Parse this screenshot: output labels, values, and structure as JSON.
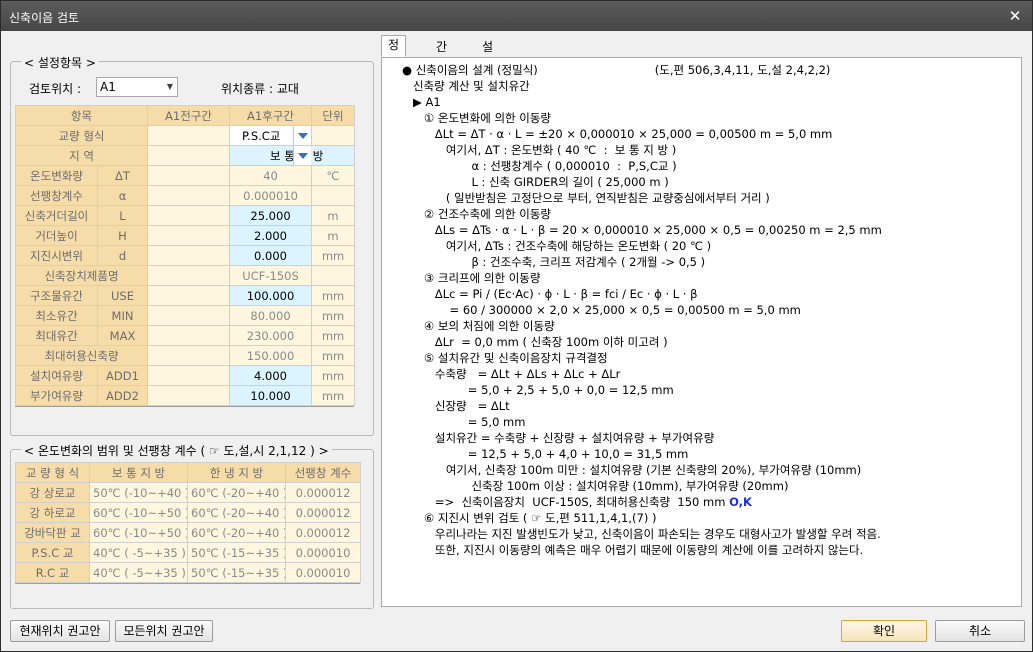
{
  "window": {
    "title": "신축이음 검토",
    "close": "✕"
  },
  "settings": {
    "group_title": "< 설정항목 >",
    "location_label": "검토위치 :",
    "location_value": "A1",
    "type_label": "위치종류 : 교대",
    "headers": [
      "항목",
      "A1전구간",
      "A1후구간",
      "단위"
    ],
    "rows": [
      {
        "label": "교량  형식",
        "front": "",
        "back": "P.S.C교",
        "unit": "",
        "kind": "select"
      },
      {
        "label": "지      역",
        "front": "",
        "back": "",
        "unit": "",
        "kind": "region",
        "value": "보 통 지 방"
      },
      {
        "label": "온도변화량",
        "symbol": "ΔT",
        "front": "",
        "back": "40",
        "unit": "℃"
      },
      {
        "label": "선팽창계수",
        "symbol": "α",
        "front": "",
        "back": "0.000010",
        "unit": ""
      },
      {
        "label": "신축거더길이",
        "symbol": "L",
        "front": "",
        "back": "25.000",
        "unit": "m",
        "edit": true
      },
      {
        "label": "거더높이",
        "symbol": "H",
        "front": "",
        "back": "2.000",
        "unit": "m",
        "edit": true
      },
      {
        "label": "지진시변위",
        "symbol": "d",
        "front": "",
        "back": "0.000",
        "unit": "mm",
        "edit": true
      },
      {
        "label": "신축장치제품명",
        "front": "",
        "back": "UCF-150S",
        "unit": "",
        "wide": true
      },
      {
        "label": "구조물유간",
        "symbol": "USE",
        "front": "",
        "back": "100.000",
        "unit": "mm",
        "edit": true
      },
      {
        "label": "최소유간",
        "symbol": "MIN",
        "front": "",
        "back": "80.000",
        "unit": "mm"
      },
      {
        "label": "최대유간",
        "symbol": "MAX",
        "front": "",
        "back": "230.000",
        "unit": "mm"
      },
      {
        "label": "최대허용신축량",
        "front": "",
        "back": "150.000",
        "unit": "mm",
        "wide": true
      },
      {
        "label": "설치여유량",
        "symbol": "ADD1",
        "front": "",
        "back": "4.000",
        "unit": "mm",
        "edit": true
      },
      {
        "label": "부가여유량",
        "symbol": "ADD2",
        "front": "",
        "back": "10.000",
        "unit": "mm",
        "edit": true
      }
    ]
  },
  "temp_range": {
    "group_title": "< 온도변화의 범위 및 선팽창 계수 ( ☞ 도,설,시 2,1,12 ) >",
    "headers": [
      "교 량 형 식",
      "보 통 지 방",
      "한 냉 지 방",
      "선팽창 계수"
    ],
    "rows": [
      [
        "강 상로교",
        "50℃ (-10~+40 )",
        "60℃ (-20~+40 )",
        "0.000012"
      ],
      [
        "강 하로교",
        "60℃ (-10~+50 )",
        "60℃ (-20~+40 )",
        "0.000012"
      ],
      [
        "강바닥판 교",
        "60℃ (-10~+50 )",
        "60℃ (-20~+40 )",
        "0.000012"
      ],
      [
        "P.S.C 교",
        "40℃ ( -5~+35 )",
        "50℃ (-15~+35 )",
        "0.000010"
      ],
      [
        "R.C 교",
        "40℃ ( -5~+35 )",
        "50℃ (-15~+35 )",
        "0.000010"
      ]
    ]
  },
  "tabs": [
    "정밀식",
    "간편식",
    "설계점검"
  ],
  "report": {
    "lines": [
      "● 신축이음의 설계 (정밀식)                                (도,편 506,3,4,11, 도,설 2,4,2,2)",
      "   신축량 계산 및 설치유간",
      "   ▶ A1",
      "      ① 온도변화에 의한 이동량",
      "         ΔLt = ΔT · α · L = ±20 × 0,000010 × 25,000 = 0,00500 m = 5,0 mm",
      "            여기서, ΔT : 온도변화 ( 40 ℃  :  보 통 지 방 )",
      "                   α : 선팽창계수 ( 0,000010  :  P,S,C교 )",
      "                   L : 신축 GIRDER의 길이 ( 25,000 m )",
      "            ( 일반받침은 고정단으로 부터, 연직받침은 교량중심에서부터 거리 )",
      "      ② 건조수축에 의한 이동량",
      "         ΔLs = ΔTs · α · L · β = 20 × 0,000010 × 25,000 × 0,5 = 0,00250 m = 2,5 mm",
      "            여기서, ΔTs : 건조수축에 해당하는 온도변화 ( 20 ℃ )",
      "                   β : 건조수축, 크리프 저감계수 ( 2개월 -> 0,5 )",
      "      ③ 크리프에 의한 이동량",
      "         ΔLc = Pi / (Ec·Ac) · ϕ · L · β = fci / Ec · ϕ · L · β",
      "             = 60 / 300000 × 2,0 × 25,000 × 0,5 = 0,00500 m = 5,0 mm",
      "      ④ 보의 처짐에 의한 이동량",
      "         ΔLr  = 0,0 mm ( 신축장 100m 이하 미고려 )",
      "      ⑤ 설치유간 및 신축이음장치 규격결정",
      "         수축량   = ΔLt + ΔLs + ΔLc + ΔLr",
      "                  = 5,0 + 2,5 + 5,0 + 0,0 = 12,5 mm",
      "         신장량   = ΔLt",
      "                  = 5,0 mm",
      "         설치유간 = 수축량 + 신장량 + 설치여유량 + 부가여유량",
      "                  = 12,5 + 5,0 + 4,0 + 10,0 = 31,5 mm",
      "            여기서, 신축장 100m 미만 : 설치여유량 (기본 신축량의 20%), 부가여유량 (10mm)",
      "                   신축장 100m 이상 : 설치여유량 (10mm), 부가여유량 (20mm)",
      "         =>  신축이음장치  UCF-150S, 최대허용신축량  150 mm ",
      "      ⑥ 지진시 변위 검토 ( ☞ 도,편 511,1,4,1,(7) )",
      "         우리나라는 지진 발생빈도가 낮고, 신축이음이 파손되는 경우도 대형사고가 발생할 우려 적음.",
      "         또한, 지진시 이동량의 예측은 매우 어렵기 때문에 이동량의 계산에 이를 고려하지 않는다."
    ],
    "ok_mark": "O,K"
  },
  "buttons": {
    "current_recommend": "현재위치 권고안",
    "all_recommend": "모든위치 권고안",
    "ok": "확인",
    "cancel": "취소"
  }
}
